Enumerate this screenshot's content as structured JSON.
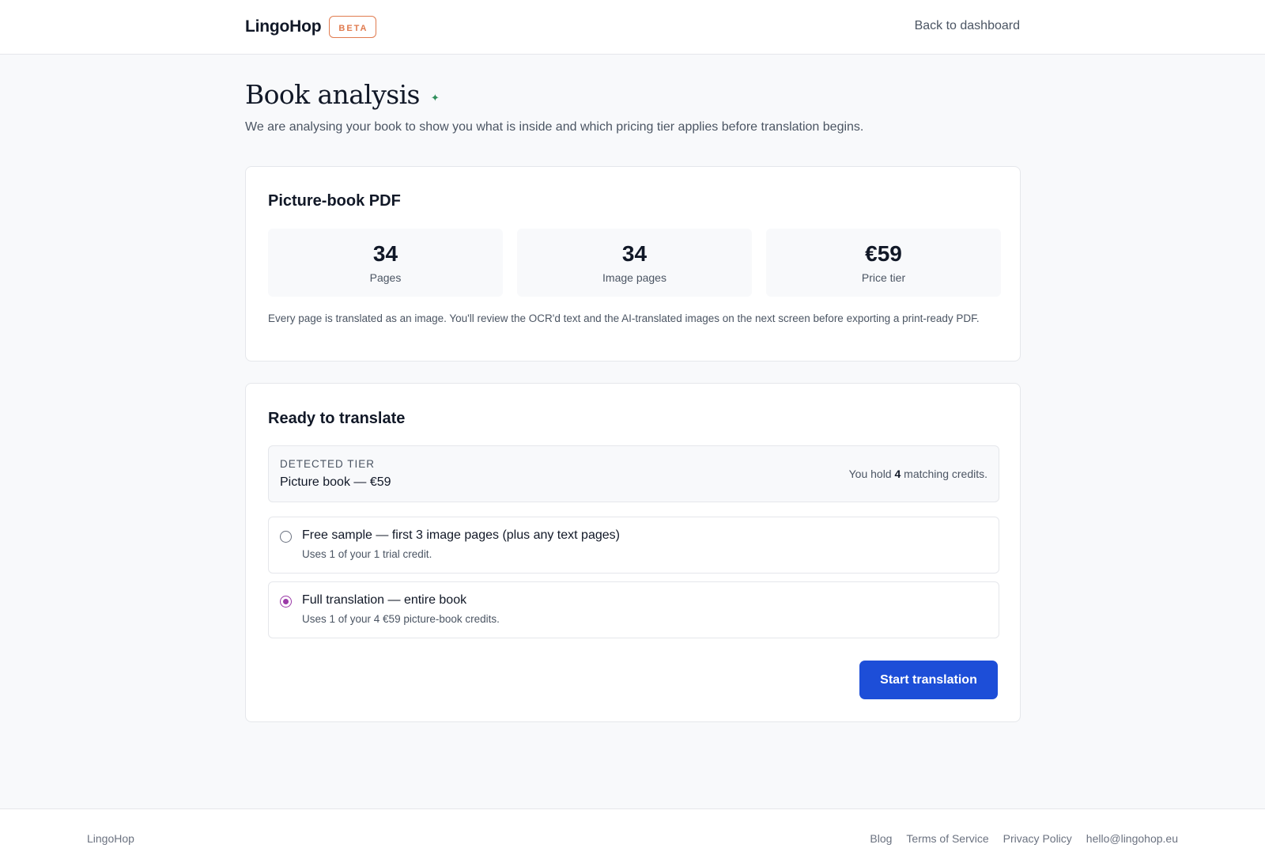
{
  "header": {
    "brand": "LingoHop",
    "badge": "BETA",
    "back_link": "Back to dashboard"
  },
  "page": {
    "title": "Book analysis",
    "sparkle_icon": "sparkle-icon",
    "subtitle": "We are analysing your book to show you what is inside and which pricing tier applies before translation begins."
  },
  "analysis": {
    "heading": "Picture-book PDF",
    "stats": [
      {
        "value": "34",
        "label": "Pages"
      },
      {
        "value": "34",
        "label": "Image pages"
      },
      {
        "value": "€59",
        "label": "Price tier"
      }
    ],
    "note": "Every page is translated as an image. You'll review the OCR'd text and the AI-translated images on the next screen before exporting a print-ready PDF."
  },
  "ready": {
    "heading": "Ready to translate",
    "tier_caption": "DETECTED TIER",
    "tier_value": "Picture book — €59",
    "credits_prefix": "You hold ",
    "credits_count": "4",
    "credits_suffix": " matching credits.",
    "options": [
      {
        "title": "Free sample — first 3 image pages (plus any text pages)",
        "desc": "Uses 1 of your 1 trial credit.",
        "selected": false
      },
      {
        "title": "Full translation — entire book",
        "desc": "Uses 1 of your 4 €59 picture-book credits.",
        "selected": true
      }
    ],
    "start_button": "Start translation"
  },
  "footer": {
    "brand": "LingoHop",
    "links": [
      "Blog",
      "Terms of Service",
      "Privacy Policy",
      "hello@lingohop.eu"
    ]
  },
  "colors": {
    "accent_button": "#1d4ed8",
    "beta_badge": "#e07b4f",
    "radio_selected": "#9b3aa8",
    "sparkle": "#2f8f5b"
  }
}
